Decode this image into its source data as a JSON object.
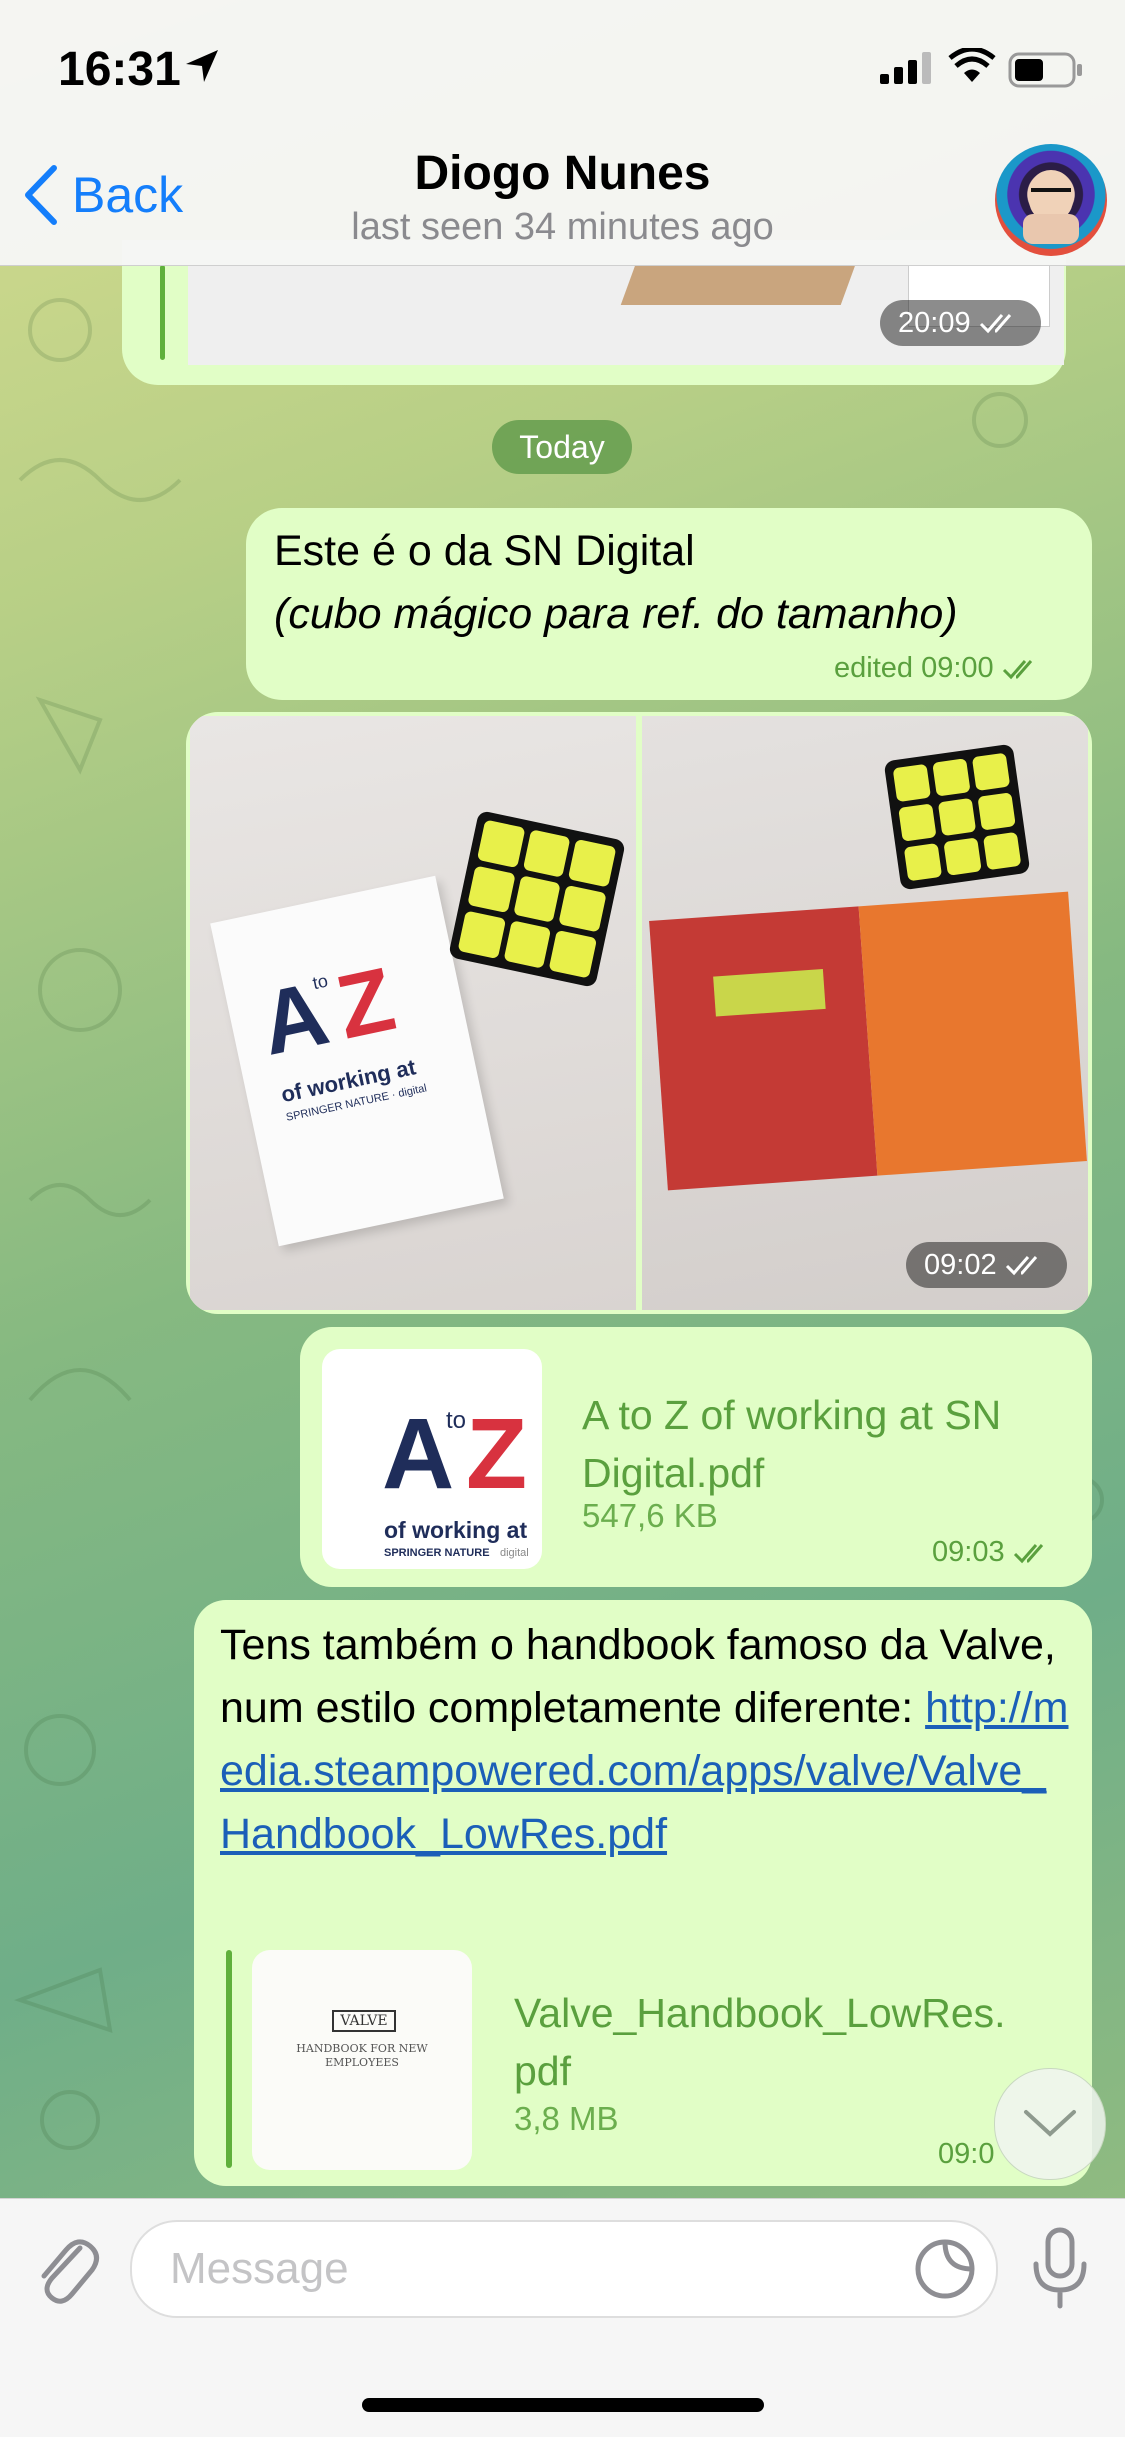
{
  "status_bar": {
    "time": "16:31"
  },
  "header": {
    "back_label": "Back",
    "title": "Diogo Nunes",
    "subtitle": "last seen 34 minutes ago"
  },
  "messages": {
    "top_photo_time": "20:09",
    "date_separator": "Today",
    "text1_line1": "Este é o da SN Digital",
    "text1_line2": "(cubo mágico para ref. do tamanho)",
    "text1_meta": "edited 09:00",
    "album_time": "09:02",
    "file": {
      "name": "A to Z of working at SN Digital.pdf",
      "size": "547,6 KB",
      "time": "09:03"
    },
    "file_thumb": {
      "big_a": "A",
      "to": "to",
      "big_z": "Z",
      "caption": "of working at",
      "brand": "SPRINGER NATURE",
      "brand_sub": "digital"
    },
    "valve": {
      "text": "Tens também o handbook famoso da Valve, num estilo completamente diferente: ",
      "link": "http://media.steampowered.com/apps/valve/Valve_Handbook_LowRes.pdf",
      "preview_name": "Valve_Handbook_LowRes.pdf",
      "preview_size": "3,8 MB",
      "preview_logo": "VALVE",
      "preview_caption": "HANDBOOK FOR NEW EMPLOYEES",
      "time": "09:0"
    }
  },
  "input": {
    "placeholder": "Message"
  },
  "colors": {
    "accent": "#147efb",
    "bubble": "#e1fec6",
    "bubble_meta": "#5aa03e",
    "link": "#1b5fb8"
  }
}
